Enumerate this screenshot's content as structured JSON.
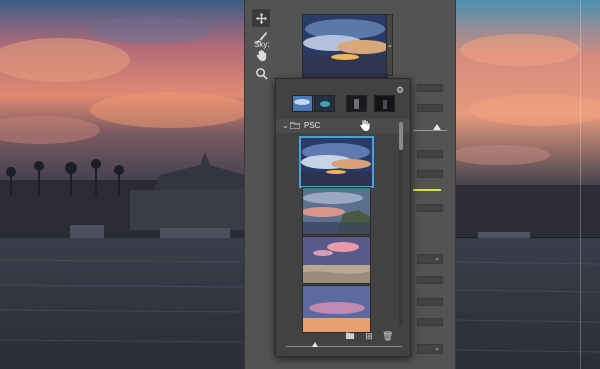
{
  "dialog": {
    "sky_label": "Sky:",
    "tools": [
      "move-sky-tool-icon",
      "sky-brush-tool-icon",
      "hand-tool-icon",
      "zoom-tool-icon"
    ]
  },
  "sky_popup": {
    "folder_name": "PSC",
    "folder_expanded": true,
    "category_thumbnails": [
      "blue-sky",
      "spectacular",
      "sunset",
      "dark"
    ],
    "sky_thumbnails": [
      "sunset-clouds-selected",
      "coastal-sunset",
      "pink-clouds-beach",
      "purple-dusk"
    ],
    "bottom_icons": [
      "new-group-icon",
      "new-sky-icon",
      "delete-icon"
    ]
  },
  "colors": {
    "dialog_bg": "#535353",
    "popup_bg": "#424242",
    "selection_accent": "#4aa0d8",
    "highlight_line": "#e0dc3c"
  }
}
